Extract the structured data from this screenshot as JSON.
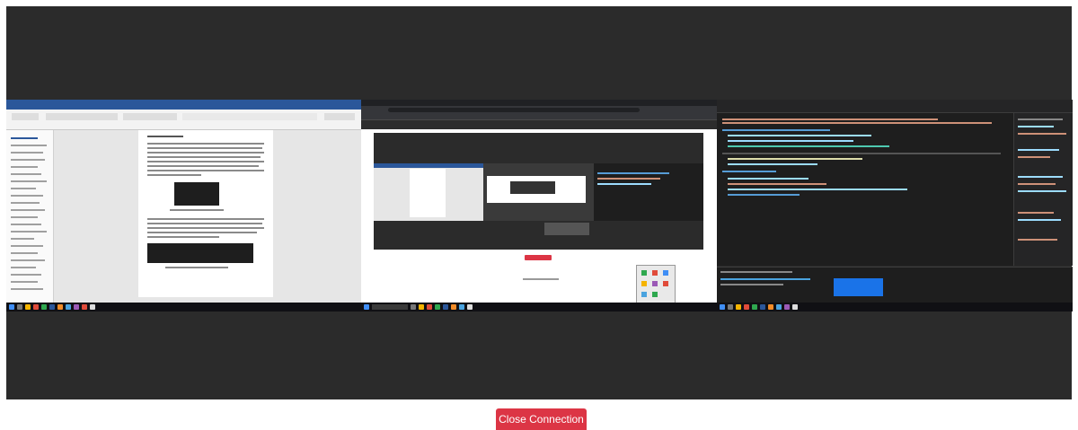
{
  "remote_view": {
    "screens": [
      {
        "name": "Microsoft Word document window"
      },
      {
        "name": "Web browser window"
      },
      {
        "name": "Developer tools / code editor window"
      }
    ]
  },
  "colors": {
    "viewer_background": "#2b2b2b",
    "close_button": "#dc3545",
    "word_accent": "#2b579a",
    "taskbar": "#101014"
  },
  "actions": {
    "close_connection_label": "Close Connection"
  }
}
